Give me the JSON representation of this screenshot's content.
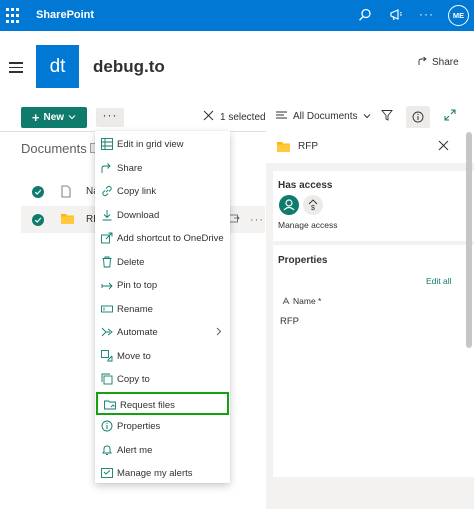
{
  "suite": {
    "brand": "SharePoint",
    "user_initials": "ME"
  },
  "site": {
    "logo_text": "dt",
    "title": "debug.to",
    "share_label": "Share"
  },
  "commandbar": {
    "new_label": "New",
    "more_label": "···",
    "selected_label": "1 selected",
    "view_label": "All Documents"
  },
  "library": {
    "title": "Documents",
    "column_name": "Na",
    "row_name": "RF"
  },
  "menu": {
    "items": [
      {
        "label": "Edit in grid view",
        "icon": "grid-icon"
      },
      {
        "label": "Share",
        "icon": "share-icon"
      },
      {
        "label": "Copy link",
        "icon": "link-icon"
      },
      {
        "label": "Download",
        "icon": "download-icon"
      },
      {
        "label": "Add shortcut to OneDrive",
        "icon": "shortcut-icon"
      },
      {
        "label": "Delete",
        "icon": "trash-icon"
      },
      {
        "label": "Pin to top",
        "icon": "pin-icon"
      },
      {
        "label": "Rename",
        "icon": "rename-icon"
      },
      {
        "label": "Automate",
        "icon": "automate-icon",
        "submenu": true
      },
      {
        "label": "Move to",
        "icon": "move-icon"
      },
      {
        "label": "Copy to",
        "icon": "copy-icon"
      },
      {
        "label": "Request files",
        "icon": "request-files-icon",
        "highlighted": true
      },
      {
        "label": "Properties",
        "icon": "properties-icon"
      },
      {
        "label": "Alert me",
        "icon": "bell-icon"
      },
      {
        "label": "Manage my alerts",
        "icon": "alerts-icon"
      }
    ]
  },
  "details": {
    "title": "RFP",
    "has_access_heading": "Has access",
    "manage_access_label": "Manage access",
    "properties_heading": "Properties",
    "edit_all_label": "Edit all",
    "name_field_label": "Name *",
    "name_field_value": "RFP"
  },
  "colors": {
    "suite_blue": "#0078d4",
    "accent_green": "#0f7b6c",
    "highlight_green": "#13a10e"
  }
}
